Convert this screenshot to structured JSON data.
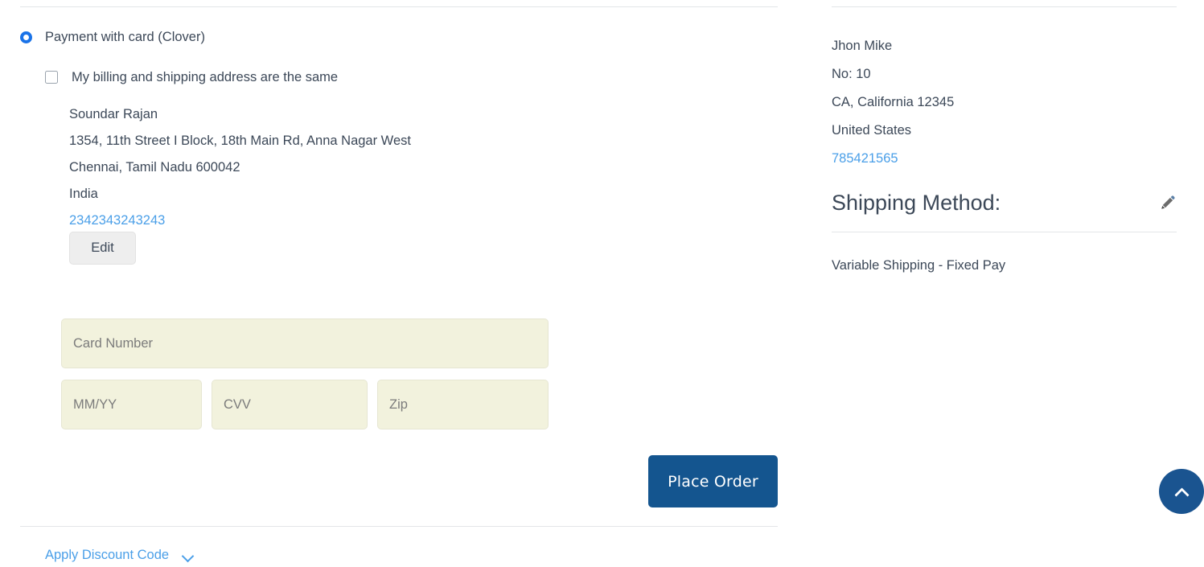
{
  "payment": {
    "method_label": "Payment with card (Clover)",
    "method_selected": true,
    "same_address_label": "My billing and shipping address are the same",
    "same_address_checked": false,
    "billing_address": {
      "name": "Soundar Rajan",
      "street": "1354, 11th Street I Block, 18th Main Rd, Anna Nagar West",
      "city_state_zip": "Chennai, Tamil Nadu 600042",
      "country": "India",
      "phone": "2342343243243"
    },
    "edit_label": "Edit",
    "card_form": {
      "card_number_placeholder": "Card Number",
      "card_number_value": "",
      "expiry_placeholder": "MM/YY",
      "expiry_value": "",
      "cvv_placeholder": "CVV",
      "cvv_value": "",
      "zip_placeholder": "Zip",
      "zip_value": ""
    },
    "place_order_label": "Place Order"
  },
  "discount": {
    "label": "Apply Discount Code",
    "expand_icon": "chevron-down-icon"
  },
  "summary": {
    "shipping_address": {
      "name": "Jhon Mike",
      "street": "No: 10",
      "city_state_zip": "CA, California 12345",
      "country": "United States",
      "phone": "785421565"
    },
    "shipping_method_heading": "Shipping Method:",
    "shipping_method_edit_icon": "pencil-icon",
    "shipping_method_value": "Variable Shipping - Fixed Pay"
  },
  "scroll_top": {
    "icon": "chevron-up-icon"
  },
  "colors": {
    "link": "#4a9fe8",
    "accent": "#1a73e8",
    "primary_button": "#14558f",
    "scroll_button": "#1a5490",
    "field_background": "#f2f2dd",
    "text": "#3c4858",
    "divider": "#e3e5e8"
  }
}
